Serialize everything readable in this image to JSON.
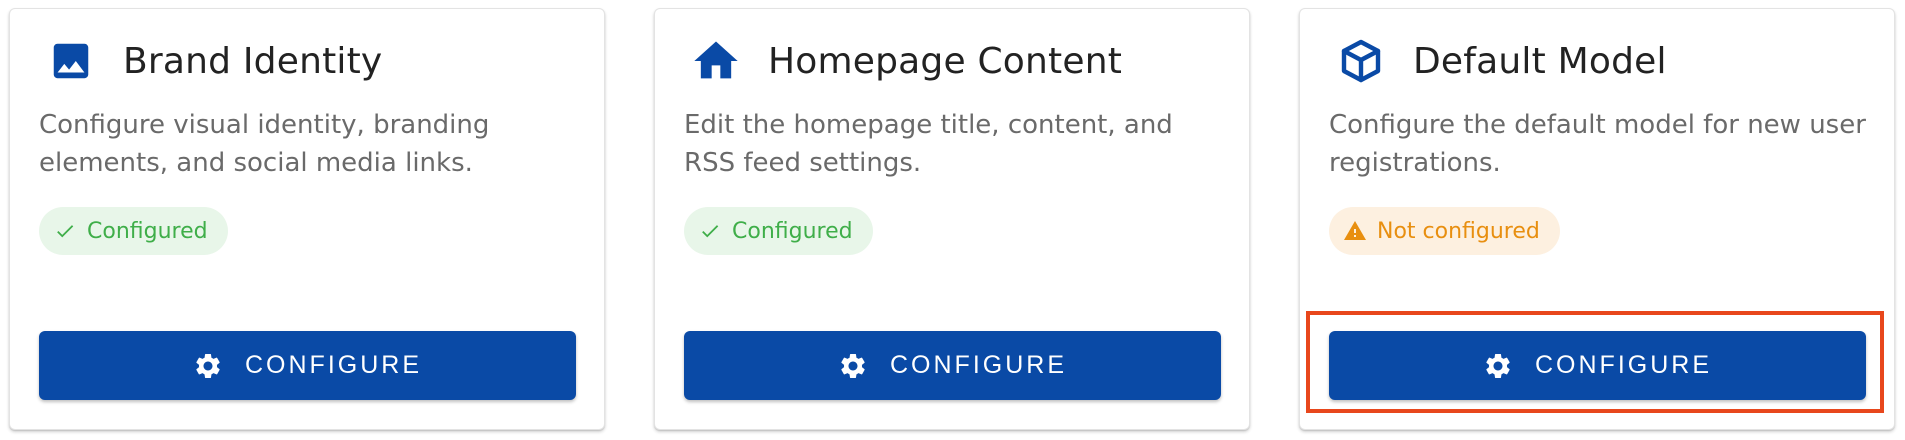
{
  "cards": [
    {
      "icon": "image-icon",
      "title": "Brand Identity",
      "description": "Configure visual identity, branding elements, and social media links.",
      "status": "Configured",
      "status_type": "ok",
      "status_icon": "check-icon",
      "button_label": "CONFIGURE",
      "button_icon": "gear-icon"
    },
    {
      "icon": "home-icon",
      "title": "Homepage Content",
      "description": "Edit the homepage title, content, and RSS feed settings.",
      "status": "Configured",
      "status_type": "ok",
      "status_icon": "check-icon",
      "button_label": "CONFIGURE",
      "button_icon": "gear-icon"
    },
    {
      "icon": "cube-icon",
      "title": "Default Model",
      "description": "Configure the default model for new user registrations.",
      "status": "Not configured",
      "status_type": "warn",
      "status_icon": "warning-icon",
      "button_label": "CONFIGURE",
      "button_icon": "gear-icon"
    }
  ],
  "colors": {
    "primary": "#0a4aa6",
    "success": "#3fae49",
    "success_bg": "#e8f6e9",
    "warning": "#e88f10",
    "warning_bg": "#fdf0e0",
    "highlight": "#e8471c"
  }
}
